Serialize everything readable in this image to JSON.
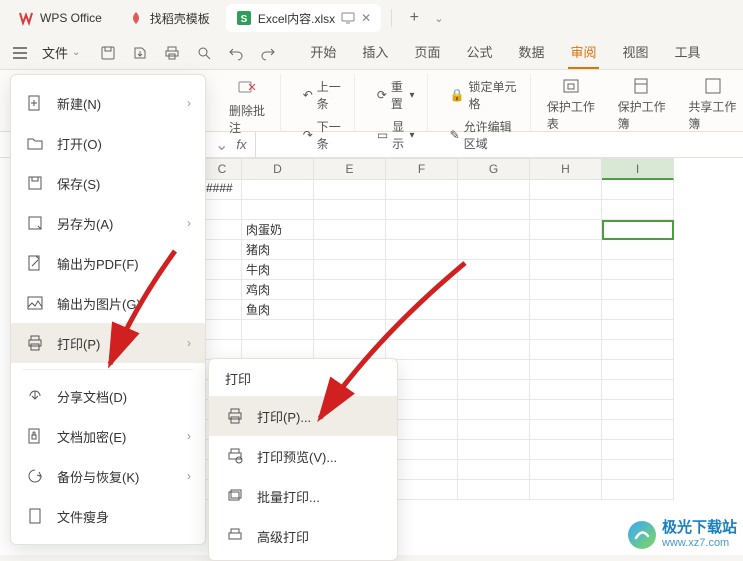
{
  "titlebar": {
    "tabs": [
      {
        "label": "WPS Office"
      },
      {
        "label": "找稻壳模板"
      },
      {
        "label": "Excel内容.xlsx"
      }
    ],
    "add": "+"
  },
  "toolbar": {
    "file_label": "文件",
    "ribbon_tabs": [
      "开始",
      "插入",
      "页面",
      "公式",
      "数据",
      "审阅",
      "视图",
      "工具"
    ],
    "active_ribbon": "审阅"
  },
  "ribbon": {
    "delete_comment": "删除批注",
    "prev": "上一条",
    "next": "下一条",
    "reset": "重置",
    "display": "显示",
    "lock_cell": "锁定单元格",
    "allow_edit": "允许编辑区域",
    "protect_sheet": "保护工作表",
    "protect_book": "保护工作簿",
    "share_book": "共享工作簿"
  },
  "formula_bar": {
    "fx": "fx"
  },
  "sheet": {
    "columns": [
      "C",
      "D",
      "E",
      "F",
      "G",
      "H",
      "I"
    ],
    "rows": [
      {
        "cells": [
          "####",
          "",
          "",
          "",
          "",
          "",
          ""
        ]
      },
      {
        "cells": [
          "",
          "",
          "",
          "",
          "",
          "",
          ""
        ]
      },
      {
        "cells": [
          "",
          "肉蛋奶",
          "",
          "",
          "",
          "",
          ""
        ]
      },
      {
        "cells": [
          "",
          "猪肉",
          "",
          "",
          "",
          "",
          ""
        ]
      },
      {
        "cells": [
          "",
          "牛肉",
          "",
          "",
          "",
          "",
          ""
        ]
      },
      {
        "cells": [
          "",
          "鸡肉",
          "",
          "",
          "",
          "",
          ""
        ]
      },
      {
        "cells": [
          "",
          "鱼肉",
          "",
          "",
          "",
          "",
          ""
        ]
      }
    ],
    "active_col_index": 6
  },
  "file_menu": {
    "items": [
      {
        "label": "新建(N)",
        "icon": "new",
        "chev": true
      },
      {
        "label": "打开(O)",
        "icon": "open"
      },
      {
        "label": "保存(S)",
        "icon": "save"
      },
      {
        "label": "另存为(A)",
        "icon": "saveas",
        "chev": true
      },
      {
        "label": "输出为PDF(F)",
        "icon": "pdf"
      },
      {
        "label": "输出为图片(G)",
        "icon": "image"
      },
      {
        "label": "打印(P)",
        "icon": "print",
        "chev": true,
        "hovered": true
      },
      {
        "label": "分享文档(D)",
        "icon": "share"
      },
      {
        "label": "文档加密(E)",
        "icon": "encrypt",
        "chev": true
      },
      {
        "label": "备份与恢复(K)",
        "icon": "backup",
        "chev": true
      },
      {
        "label": "文件瘦身",
        "icon": "slim"
      }
    ]
  },
  "print_submenu": {
    "title": "打印",
    "items": [
      {
        "label": "打印(P)...",
        "icon": "print",
        "hovered": true
      },
      {
        "label": "打印预览(V)...",
        "icon": "preview"
      },
      {
        "label": "批量打印...",
        "icon": "batch"
      },
      {
        "label": "高级打印",
        "icon": "advanced"
      }
    ]
  },
  "watermark": {
    "name": "极光下载站",
    "url": "www.xz7.com"
  }
}
